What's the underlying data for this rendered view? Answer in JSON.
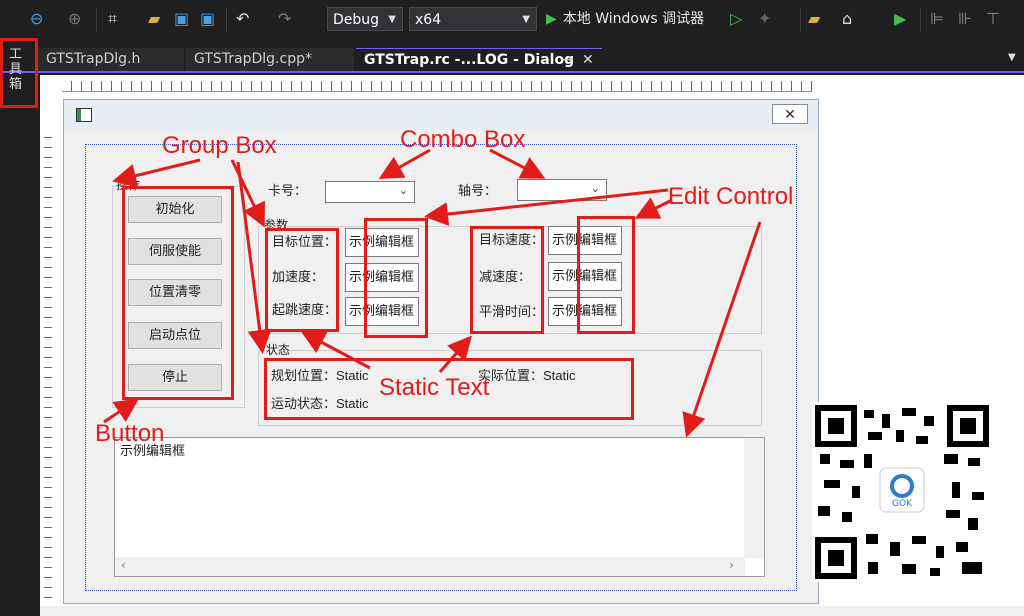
{
  "toolbar": {
    "config": "Debug",
    "platform": "x64",
    "run_label": "本地 Windows 调试器"
  },
  "tabs": [
    {
      "label": "GTSTrapDlg.h"
    },
    {
      "label": "GTSTrapDlg.cpp*"
    },
    {
      "label": "GTSTrap.rc -...LOG - Dialog"
    }
  ],
  "toolbox_label": "工具箱",
  "dialog": {
    "group_ops": "操作",
    "buttons": [
      "初始化",
      "伺服使能",
      "位置清零",
      "启动点位",
      "停止"
    ],
    "card_label": "卡号：",
    "axis_label": "轴号：",
    "group_params": "参数",
    "params_left": [
      "目标位置：",
      "加速度：",
      "起跳速度："
    ],
    "params_right": [
      "目标速度：",
      "减速度：",
      "平滑时间："
    ],
    "edit_text": "示例编辑框",
    "group_status": "状态",
    "status": {
      "plan_pos_label": "规划位置：",
      "plan_pos_value": "Static",
      "actual_pos_label": "实际位置：",
      "actual_pos_value": "Static",
      "motion_label": "运动状态：",
      "motion_value": "Static"
    },
    "memo_text": "示例编辑框"
  },
  "annotations": {
    "group_box": "Group Box",
    "combo_box": "Combo Box",
    "edit_control": "Edit Control",
    "static_text": "Static Text",
    "button": "Button"
  },
  "colors": {
    "annotation_red": "#e21b1b",
    "accent_purple": "#7160e8",
    "run_green": "#3fbf4f"
  }
}
